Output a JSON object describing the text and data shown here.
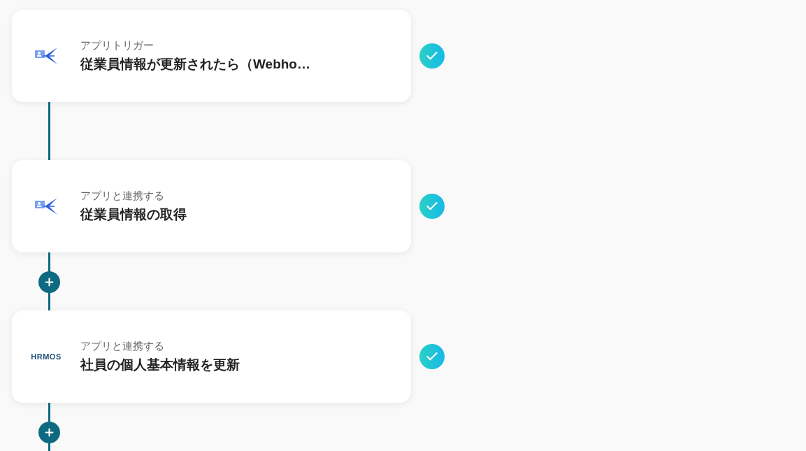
{
  "steps": [
    {
      "kind": "person-app",
      "category": "アプリトリガー",
      "title": "従業員情報が更新されたら（Webho…",
      "done": true,
      "add_button_after": false
    },
    {
      "kind": "person-app",
      "category": "アプリと連携する",
      "title": "従業員情報の取得",
      "done": true,
      "add_button_after": true
    },
    {
      "kind": "hrmos",
      "logo_text": "HRMOS",
      "category": "アプリと連携する",
      "title": "社員の個人基本情報を更新",
      "done": true,
      "add_button_after": true
    }
  ]
}
